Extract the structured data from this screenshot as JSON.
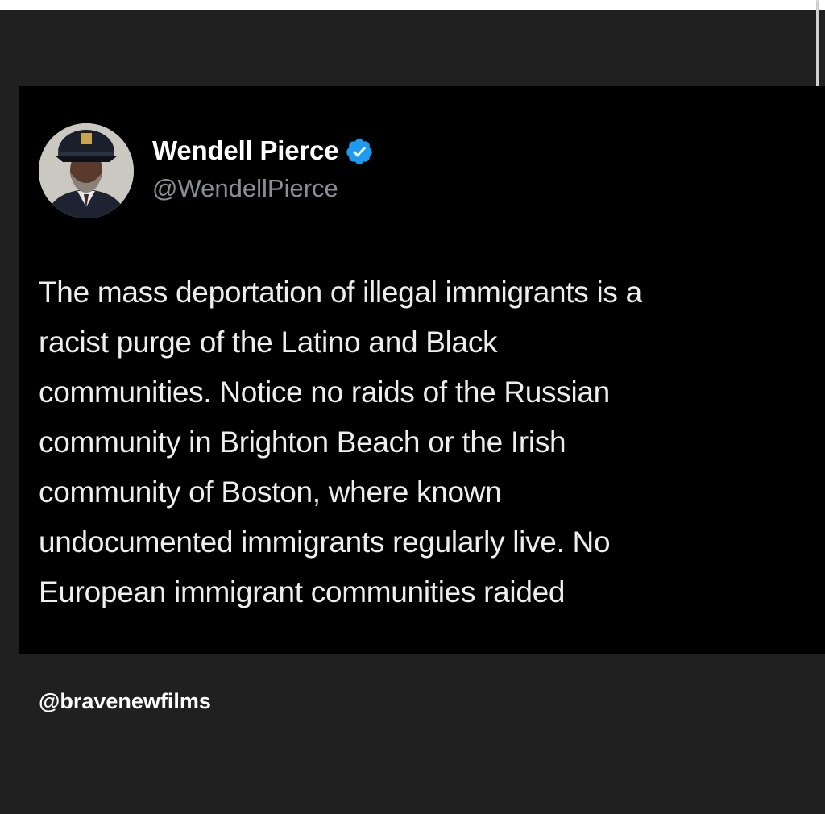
{
  "tweet": {
    "display_name": "Wendell Pierce",
    "handle": "@WendellPierce",
    "verified_icon": "verified-badge-icon",
    "verified_color": "#1d9bf0",
    "text_lines": [
      "The mass deportation of illegal immigrants is a",
      "racist purge of the Latino and Black",
      "communities. Notice no raids of the Russian",
      "community in Brighton Beach or the Irish",
      "community of Boston, where known",
      "undocumented immigrants regularly live. No",
      "European immigrant communities raided"
    ]
  },
  "credit": "@bravenewfilms",
  "colors": {
    "page_background": "#202020",
    "card_background": "#000000",
    "handle_gray": "#8b8f94"
  }
}
